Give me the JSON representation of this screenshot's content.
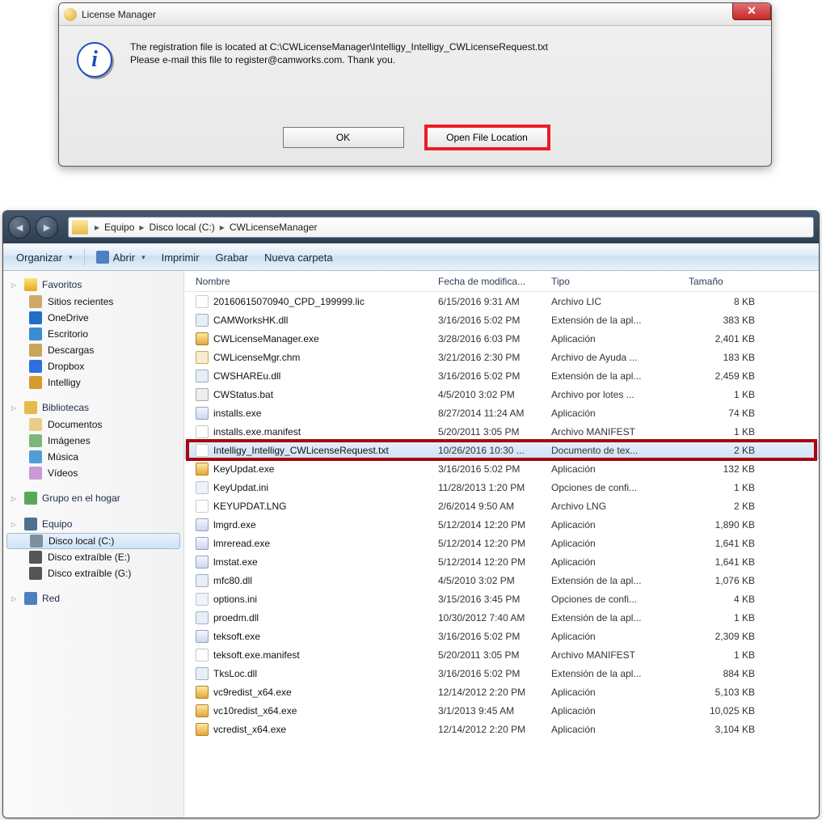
{
  "dialog": {
    "title": "License Manager",
    "line1": "The registration file is located at C:\\CWLicenseManager\\Intelligy_Intelligy_CWLicenseRequest.txt",
    "line2": "Please e-mail this file to register@camworks.com.  Thank you.",
    "ok": "OK",
    "open": "Open File Location"
  },
  "explorer": {
    "breadcrumb": [
      "Equipo",
      "Disco local (C:)",
      "CWLicenseManager"
    ],
    "toolbar": {
      "organize": "Organizar",
      "open": "Abrir",
      "print": "Imprimir",
      "burn": "Grabar",
      "newfolder": "Nueva carpeta"
    },
    "sidebar": {
      "fav": "Favoritos",
      "favitems": [
        "Sitios recientes",
        "OneDrive",
        "Escritorio",
        "Descargas",
        "Dropbox",
        "Intelligy"
      ],
      "lib": "Bibliotecas",
      "libitems": [
        "Documentos",
        "Imágenes",
        "Música",
        "Vídeos"
      ],
      "home": "Grupo en el hogar",
      "pc": "Equipo",
      "pcitems": [
        "Disco local (C:)",
        "Disco extraíble (E:)",
        "Disco extraíble (G:)"
      ],
      "net": "Red"
    },
    "columns": {
      "name": "Nombre",
      "date": "Fecha de modifica...",
      "type": "Tipo",
      "size": "Tamaño"
    },
    "files": [
      {
        "ic": "lic",
        "n": "20160615070940_CPD_199999.lic",
        "d": "6/15/2016 9:31 AM",
        "t": "Archivo LIC",
        "s": "8 KB"
      },
      {
        "ic": "dll",
        "n": "CAMWorksHK.dll",
        "d": "3/16/2016 5:02 PM",
        "t": "Extensión de la apl...",
        "s": "383 KB"
      },
      {
        "ic": "shield",
        "n": "CWLicenseManager.exe",
        "d": "3/28/2016 6:03 PM",
        "t": "Aplicación",
        "s": "2,401 KB"
      },
      {
        "ic": "chm",
        "n": "CWLicenseMgr.chm",
        "d": "3/21/2016 2:30 PM",
        "t": "Archivo de Ayuda ...",
        "s": "183 KB"
      },
      {
        "ic": "dll",
        "n": "CWSHAREu.dll",
        "d": "3/16/2016 5:02 PM",
        "t": "Extensión de la apl...",
        "s": "2,459 KB"
      },
      {
        "ic": "bat",
        "n": "CWStatus.bat",
        "d": "4/5/2010 3:02 PM",
        "t": "Archivo por lotes ...",
        "s": "1 KB"
      },
      {
        "ic": "exe",
        "n": "installs.exe",
        "d": "8/27/2014 11:24 AM",
        "t": "Aplicación",
        "s": "74 KB"
      },
      {
        "ic": "mf",
        "n": "installs.exe.manifest",
        "d": "5/20/2011 3:05 PM",
        "t": "Archivo MANIFEST",
        "s": "1 KB"
      },
      {
        "ic": "txt",
        "n": "Intelligy_Intelligy_CWLicenseRequest.txt",
        "d": "10/26/2016 10:30 ...",
        "t": "Documento de tex...",
        "s": "2 KB",
        "sel": true
      },
      {
        "ic": "shield",
        "n": "KeyUpdat.exe",
        "d": "3/16/2016 5:02 PM",
        "t": "Aplicación",
        "s": "132 KB"
      },
      {
        "ic": "ini",
        "n": "KeyUpdat.ini",
        "d": "11/28/2013 1:20 PM",
        "t": "Opciones de confi...",
        "s": "1 KB"
      },
      {
        "ic": "txt",
        "n": "KEYUPDAT.LNG",
        "d": "2/6/2014 9:50 AM",
        "t": "Archivo LNG",
        "s": "2 KB"
      },
      {
        "ic": "exe",
        "n": "lmgrd.exe",
        "d": "5/12/2014 12:20 PM",
        "t": "Aplicación",
        "s": "1,890 KB"
      },
      {
        "ic": "exe",
        "n": "lmreread.exe",
        "d": "5/12/2014 12:20 PM",
        "t": "Aplicación",
        "s": "1,641 KB"
      },
      {
        "ic": "exe",
        "n": "lmstat.exe",
        "d": "5/12/2014 12:20 PM",
        "t": "Aplicación",
        "s": "1,641 KB"
      },
      {
        "ic": "dll",
        "n": "mfc80.dll",
        "d": "4/5/2010 3:02 PM",
        "t": "Extensión de la apl...",
        "s": "1,076 KB"
      },
      {
        "ic": "ini",
        "n": "options.ini",
        "d": "3/15/2016 3:45 PM",
        "t": "Opciones de confi...",
        "s": "4 KB"
      },
      {
        "ic": "dll",
        "n": "proedm.dll",
        "d": "10/30/2012 7:40 AM",
        "t": "Extensión de la apl...",
        "s": "1 KB"
      },
      {
        "ic": "exe",
        "n": "teksoft.exe",
        "d": "3/16/2016 5:02 PM",
        "t": "Aplicación",
        "s": "2,309 KB"
      },
      {
        "ic": "mf",
        "n": "teksoft.exe.manifest",
        "d": "5/20/2011 3:05 PM",
        "t": "Archivo MANIFEST",
        "s": "1 KB"
      },
      {
        "ic": "dll",
        "n": "TksLoc.dll",
        "d": "3/16/2016 5:02 PM",
        "t": "Extensión de la apl...",
        "s": "884 KB"
      },
      {
        "ic": "shield",
        "n": "vc9redist_x64.exe",
        "d": "12/14/2012 2:20 PM",
        "t": "Aplicación",
        "s": "5,103 KB"
      },
      {
        "ic": "shield",
        "n": "vc10redist_x64.exe",
        "d": "3/1/2013 9:45 AM",
        "t": "Aplicación",
        "s": "10,025 KB"
      },
      {
        "ic": "shield",
        "n": "vcredist_x64.exe",
        "d": "12/14/2012 2:20 PM",
        "t": "Aplicación",
        "s": "3,104 KB"
      }
    ]
  }
}
